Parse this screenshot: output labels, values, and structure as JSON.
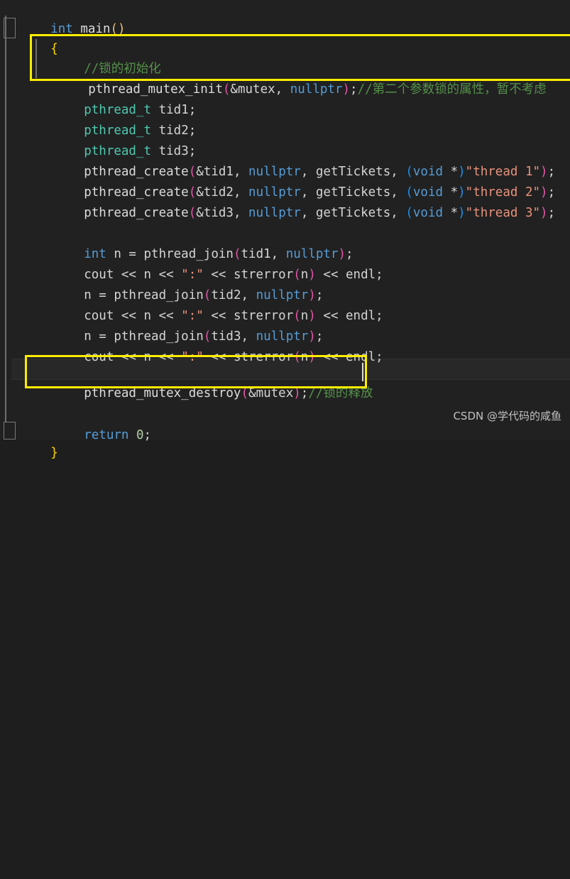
{
  "editor": {
    "theme": "dark",
    "background": "#212121",
    "foreground": "#d4d4d4",
    "font_size_px": 17.5,
    "line_height_px": 28.6,
    "language": "cpp",
    "colors": {
      "keyword": "#569cd6",
      "type": "#4ec9b0",
      "string": "#e8927c",
      "comment": "#55914a",
      "paren_magenta": "#e356a7",
      "paren_blue": "#1c8fe8",
      "paren_gold": "#e5c07b",
      "brace_gold": "#ffd700",
      "annotation_box": "#ffec00",
      "current_line": "#282828"
    }
  },
  "code": {
    "lines": [
      {
        "n": 1,
        "indent": 0,
        "text": "int main()"
      },
      {
        "n": 2,
        "indent": 0,
        "text": "{"
      },
      {
        "n": 3,
        "indent": 1,
        "text": "//锁的初始化"
      },
      {
        "n": 4,
        "indent": 1,
        "text": "pthread_mutex_init(&mutex, nullptr);//第二个参数锁的属性，暂不考虑"
      },
      {
        "n": 5,
        "indent": 1,
        "text": "pthread_t tid1;"
      },
      {
        "n": 6,
        "indent": 1,
        "text": "pthread_t tid2;"
      },
      {
        "n": 7,
        "indent": 1,
        "text": "pthread_t tid3;"
      },
      {
        "n": 8,
        "indent": 1,
        "text": "pthread_create(&tid1, nullptr, getTickets, (void *)\"thread 1\");"
      },
      {
        "n": 9,
        "indent": 1,
        "text": "pthread_create(&tid2, nullptr, getTickets, (void *)\"thread 2\");"
      },
      {
        "n": 10,
        "indent": 1,
        "text": "pthread_create(&tid3, nullptr, getTickets, (void *)\"thread 3\");"
      },
      {
        "n": 11,
        "indent": 1,
        "text": ""
      },
      {
        "n": 12,
        "indent": 1,
        "text": "int n = pthread_join(tid1, nullptr);"
      },
      {
        "n": 13,
        "indent": 1,
        "text": "cout << n << \":\" << strerror(n) << endl;"
      },
      {
        "n": 14,
        "indent": 1,
        "text": "n = pthread_join(tid2, nullptr);"
      },
      {
        "n": 15,
        "indent": 1,
        "text": "cout << n << \":\" << strerror(n) << endl;"
      },
      {
        "n": 16,
        "indent": 1,
        "text": "n = pthread_join(tid3, nullptr);"
      },
      {
        "n": 17,
        "indent": 1,
        "text": "cout << n << \":\" << strerror(n) << endl;"
      },
      {
        "n": 18,
        "indent": 1,
        "text": ""
      },
      {
        "n": 19,
        "indent": 1,
        "text": "pthread_mutex_destroy(&mutex);//锁的释放"
      },
      {
        "n": 20,
        "indent": 1,
        "text": ""
      },
      {
        "n": 21,
        "indent": 1,
        "text": "return 0;"
      },
      {
        "n": 22,
        "indent": 0,
        "text": "}"
      }
    ],
    "tokens": {
      "l1": {
        "kw": "int",
        "name": " main",
        "paren": "()"
      },
      "l2": {
        "brace": "{"
      },
      "l3": {
        "comment": "//锁的初始化"
      },
      "l4": {
        "fn": "pthread_mutex_init",
        "open": "(",
        "args": "&mutex, ",
        "nullptr": "nullptr",
        "close": ")",
        "semi": ";",
        "comment": "//第二个参数锁的属性，暂不考虑"
      },
      "l5": {
        "type": "pthread_t",
        "name": " tid1;"
      },
      "l6": {
        "type": "pthread_t",
        "name": " tid2;"
      },
      "l7": {
        "type": "pthread_t",
        "name": " tid3;"
      },
      "l8": {
        "fn": "pthread_create",
        "open": "(",
        "arg1": "&tid1, ",
        "nullptr": "nullptr",
        "arg2": ", getTickets, ",
        "cast_open": "(",
        "cast_kw": "void",
        "cast_star": " *",
        "cast_close": ")",
        "str": "\"thread 1\"",
        "close": ")",
        "semi": ";"
      },
      "l9": {
        "fn": "pthread_create",
        "open": "(",
        "arg1": "&tid2, ",
        "nullptr": "nullptr",
        "arg2": ", getTickets, ",
        "cast_open": "(",
        "cast_kw": "void",
        "cast_star": " *",
        "cast_close": ")",
        "str": "\"thread 2\"",
        "close": ")",
        "semi": ";"
      },
      "l10": {
        "fn": "pthread_create",
        "open": "(",
        "arg1": "&tid3, ",
        "nullptr": "nullptr",
        "arg2": ", getTickets, ",
        "cast_open": "(",
        "cast_kw": "void",
        "cast_star": " *",
        "cast_close": ")",
        "str": "\"thread 3\"",
        "close": ")",
        "semi": ";"
      },
      "l12": {
        "kw": "int",
        "mid": " n = pthread_join",
        "open": "(",
        "arg": "tid1, ",
        "nullptr": "nullptr",
        "close": ")",
        "semi": ";"
      },
      "l13": {
        "pre": "cout << n << ",
        "str": "\":\"",
        "mid": " << strerror",
        "open": "(",
        "arg": "n",
        "close": ")",
        "post": " << endl;"
      },
      "l14": {
        "pre": "n = pthread_join",
        "open": "(",
        "arg": "tid2, ",
        "nullptr": "nullptr",
        "close": ")",
        "semi": ";"
      },
      "l15": {
        "pre": "cout << n << ",
        "str": "\":\"",
        "mid": " << strerror",
        "open": "(",
        "arg": "n",
        "close": ")",
        "post": " << endl;"
      },
      "l16": {
        "pre": "n = pthread_join",
        "open": "(",
        "arg": "tid3, ",
        "nullptr": "nullptr",
        "close": ")",
        "semi": ";"
      },
      "l17": {
        "pre": "cout << n << ",
        "str": "\":\"",
        "mid": " << strerror",
        "open": "(",
        "arg": "n",
        "close": ")",
        "post": " << endl;"
      },
      "l19": {
        "fn": "pthread_mutex_destroy",
        "open": "(",
        "arg": "&mutex",
        "close": ")",
        "semi": ";",
        "comment": "//锁的释放"
      },
      "l21": {
        "kw": "return",
        "num": " 0",
        "semi": ";"
      },
      "l22": {
        "brace": "}"
      }
    }
  },
  "annotations": {
    "boxes": [
      {
        "label": "mutex-init-highlight",
        "color": "#ffec00"
      },
      {
        "label": "mutex-destroy-highlight",
        "color": "#ffec00"
      }
    ]
  },
  "watermark": {
    "text": "CSDN @学代码的咸鱼"
  }
}
